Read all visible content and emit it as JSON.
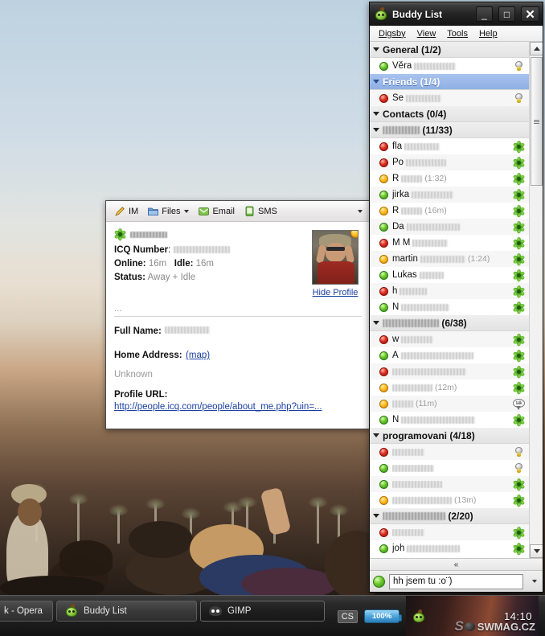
{
  "desktop": {
    "wallpaper_description": "outdoor festival crowd with palm trees"
  },
  "profile_window": {
    "toolbar": {
      "im_label": "IM",
      "files_label": "Files",
      "email_label": "Email",
      "sms_label": "SMS",
      "overflow_label": ""
    },
    "screenname_redacted": "",
    "fields": {
      "icq_number_label": "ICQ Number",
      "icq_number_value": "",
      "online_label": "Online:",
      "online_value": "16m",
      "idle_label": "Idle:",
      "idle_value": "16m",
      "status_label": "Status:",
      "status_value": "Away + Idle",
      "dots": "...",
      "full_name_label": "Full Name:",
      "full_name_value": "",
      "home_address_label": "Home Address:",
      "map_link": "(map)",
      "home_address_value": "Unknown",
      "profile_url_label": "Profile URL:",
      "profile_url_value": "http://people.icq.com/people/about_me.php?uin=..."
    },
    "avatar": {
      "status": "away"
    },
    "hide_profile_label": "Hide Profile"
  },
  "buddy_list": {
    "title": "Buddy List",
    "window_buttons": {
      "minimize": "_",
      "maximize": "□",
      "close": "✕"
    },
    "menu": [
      "Digsby",
      "View",
      "Tools",
      "Help"
    ],
    "groups": [
      {
        "label": "General (1/2)",
        "selected": false,
        "contacts": [
          {
            "name": "Věra",
            "redacted": 52,
            "status": "online",
            "idle": "",
            "proto": "bulb"
          }
        ]
      },
      {
        "label": "Friends (1/4)",
        "selected": true,
        "contacts": [
          {
            "name": "Se",
            "redacted": 44,
            "status": "busy",
            "idle": "",
            "proto": "bulb"
          }
        ]
      },
      {
        "label": "Contacts (0/4)",
        "selected": false,
        "contacts": []
      },
      {
        "label": "██████ (11/33)",
        "selected": false,
        "redacted_label": 46,
        "contacts": [
          {
            "name": "fla",
            "redacted": 44,
            "status": "busy",
            "idle": "",
            "proto": "icq"
          },
          {
            "name": "Po",
            "redacted": 50,
            "status": "busy",
            "idle": "",
            "proto": "icq"
          },
          {
            "name": "R",
            "redacted": 26,
            "status": "away",
            "idle": "(1:32)",
            "proto": "icq"
          },
          {
            "name": "jirka",
            "redacted": 52,
            "status": "online",
            "idle": "",
            "proto": "icq"
          },
          {
            "name": "R",
            "redacted": 26,
            "status": "away",
            "idle": "(16m)",
            "proto": "icq"
          },
          {
            "name": "Da",
            "redacted": 66,
            "status": "online",
            "idle": "",
            "proto": "icq"
          },
          {
            "name": "M M",
            "redacted": 44,
            "status": "busy",
            "idle": "",
            "proto": "icq"
          },
          {
            "name": "martin",
            "redacted": 56,
            "status": "away",
            "idle": "(1:24)",
            "proto": "icq"
          },
          {
            "name": "Lukas",
            "redacted": 30,
            "status": "online",
            "idle": "",
            "proto": "icq"
          },
          {
            "name": "h",
            "redacted": 34,
            "status": "busy",
            "idle": "",
            "proto": "icq"
          },
          {
            "name": "N",
            "redacted": 60,
            "status": "online",
            "idle": "",
            "proto": "icq"
          }
        ]
      },
      {
        "label": "███████ (6/38)",
        "selected": false,
        "redacted_label": 70,
        "contacts": [
          {
            "name": "w",
            "redacted": 40,
            "status": "busy",
            "idle": "",
            "proto": "icq"
          },
          {
            "name": "A",
            "redacted": 90,
            "status": "online",
            "idle": "",
            "proto": "icq"
          },
          {
            "name": "",
            "redacted": 92,
            "status": "busy",
            "idle": "",
            "proto": "icq"
          },
          {
            "name": "",
            "redacted": 50,
            "status": "away",
            "idle": "(12m)",
            "proto": "icq"
          },
          {
            "name": "",
            "redacted": 26,
            "status": "away",
            "idle": "(11m)",
            "proto": "talk"
          },
          {
            "name": "N",
            "redacted": 92,
            "status": "online",
            "idle": "",
            "proto": "icq"
          }
        ]
      },
      {
        "label": "programovani (4/18)",
        "selected": false,
        "contacts": [
          {
            "name": "",
            "redacted": 40,
            "status": "busy",
            "idle": "",
            "proto": "bulb"
          },
          {
            "name": "",
            "redacted": 52,
            "status": "online",
            "idle": "",
            "proto": "bulb"
          },
          {
            "name": "",
            "redacted": 62,
            "status": "online",
            "idle": "",
            "proto": "icq"
          },
          {
            "name": "",
            "redacted": 74,
            "status": "away",
            "idle": "(13m)",
            "proto": "icq"
          }
        ]
      },
      {
        "label": "████████ (2/20)",
        "selected": false,
        "redacted_label": 78,
        "contacts": [
          {
            "name": "",
            "redacted": 40,
            "status": "busy",
            "idle": "",
            "proto": "icq"
          },
          {
            "name": "joh",
            "redacted": 66,
            "status": "online",
            "idle": "",
            "proto": "icq"
          }
        ]
      }
    ],
    "collapse_label": "«",
    "status_message": "hh jsem tu :o¨)",
    "status_state": "online"
  },
  "taskbar": {
    "tasks": [
      {
        "label": "k - Opera",
        "icon": "opera-icon",
        "active": false
      },
      {
        "label": "Buddy List",
        "icon": "digsby-icon",
        "active": false
      },
      {
        "label": "GIMP",
        "icon": "gimp-icon",
        "active": true
      }
    ],
    "tray": {
      "language": "CS",
      "battery": "100%",
      "clock": "14:10",
      "watermark": "SWMAG.CZ"
    }
  }
}
